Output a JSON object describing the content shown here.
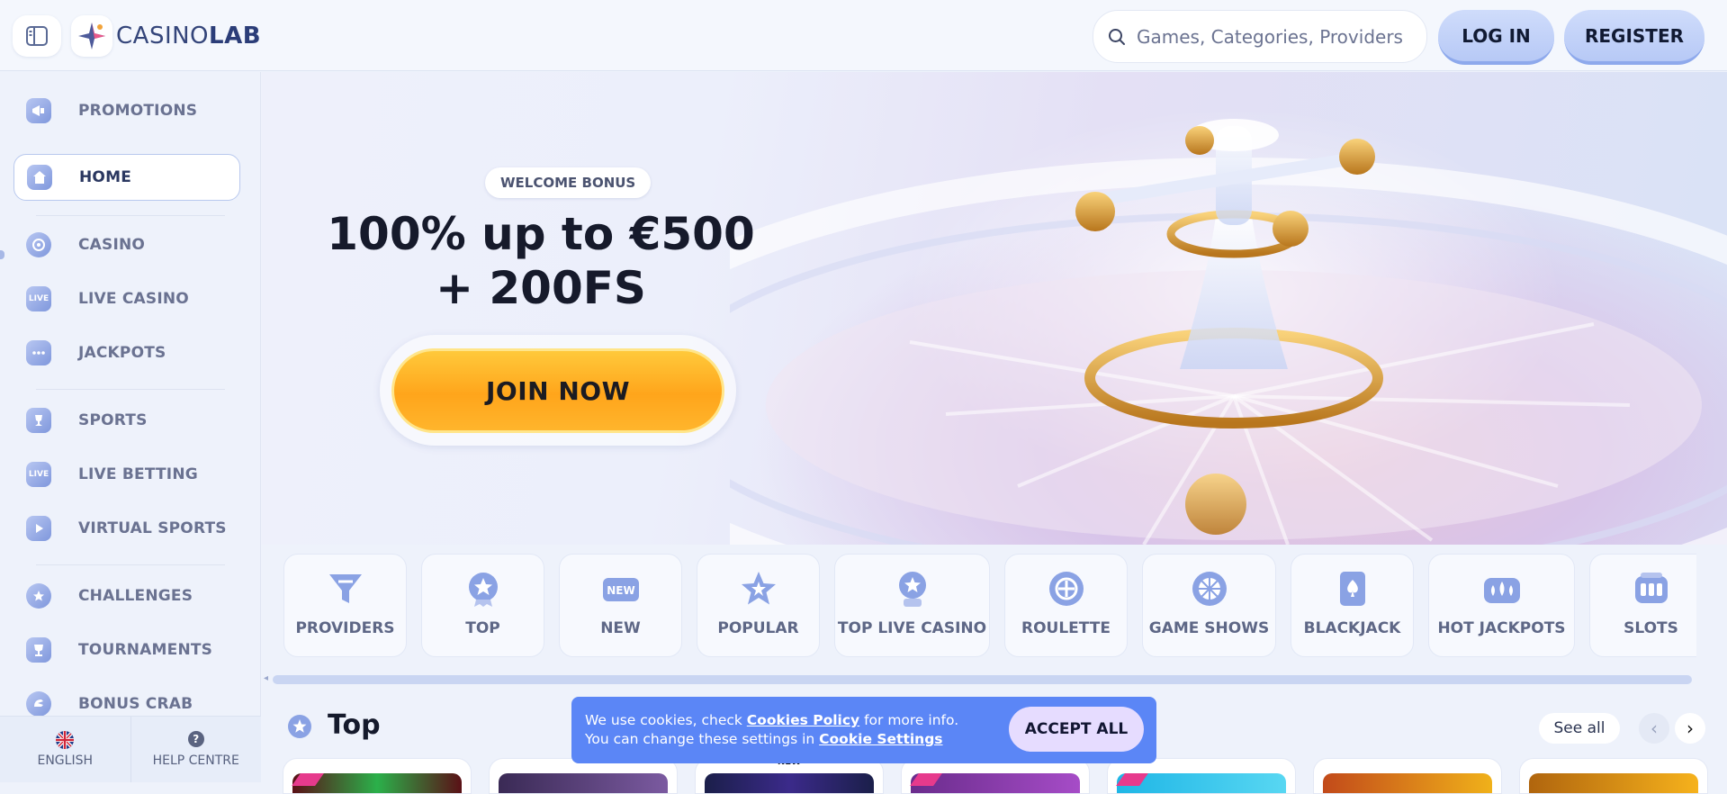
{
  "header": {
    "logo": {
      "part1": "CASINO",
      "part2": "LAB"
    },
    "search": {
      "placeholder": "Games, Categories, Providers"
    },
    "login_label": "LOG IN",
    "register_label": "REGISTER"
  },
  "sidebar": {
    "items": [
      {
        "label": "PROMOTIONS",
        "icon": "megaphone-icon"
      },
      {
        "label": "HOME",
        "icon": "home-icon"
      },
      {
        "label": "CASINO",
        "icon": "chip-icon"
      },
      {
        "label": "LIVE CASINO",
        "icon": "live-icon"
      },
      {
        "label": "JACKPOTS",
        "icon": "slot-icon"
      },
      {
        "label": "SPORTS",
        "icon": "trophy-icon"
      },
      {
        "label": "LIVE BETTING",
        "icon": "live-shield-icon"
      },
      {
        "label": "VIRTUAL SPORTS",
        "icon": "play-icon"
      },
      {
        "label": "CHALLENGES",
        "icon": "star-badge-icon"
      },
      {
        "label": "TOURNAMENTS",
        "icon": "cup-icon"
      },
      {
        "label": "BONUS CRAB",
        "icon": "claw-icon"
      }
    ],
    "footer": {
      "language_label": "ENGLISH",
      "help_label": "HELP CENTRE"
    }
  },
  "hero": {
    "badge": "WELCOME BONUS",
    "title_line1": "100% up to €500",
    "title_line2": "+ 200FS",
    "cta": "JOIN NOW"
  },
  "categories": [
    {
      "label": "PROVIDERS",
      "icon": "funnel-icon"
    },
    {
      "label": "TOP",
      "icon": "star-medal-icon"
    },
    {
      "label": "NEW",
      "icon": "new-tag-icon"
    },
    {
      "label": "POPULAR",
      "icon": "star-icon"
    },
    {
      "label": "TOP LIVE CASINO",
      "icon": "live-medal-icon"
    },
    {
      "label": "ROULETTE",
      "icon": "roulette-icon"
    },
    {
      "label": "GAME SHOWS",
      "icon": "wheel-icon"
    },
    {
      "label": "BLACKJACK",
      "icon": "spade-card-icon"
    },
    {
      "label": "HOT JACKPOTS",
      "icon": "coins-icon"
    },
    {
      "label": "SLOTS",
      "icon": "slot-machine-icon"
    }
  ],
  "section": {
    "title": "Top",
    "see_all": "See all",
    "new_tag": "NEW"
  },
  "cookie": {
    "text1": "We use cookies, check ",
    "link1": "Cookies Policy",
    "text2": " for more info. You can change these settings in ",
    "link2": "Cookie Settings",
    "accept": "ACCEPT ALL"
  },
  "colors": {
    "accent": "#5b86f6",
    "cta": "#ffa51b",
    "button": "#c3d3f8"
  }
}
